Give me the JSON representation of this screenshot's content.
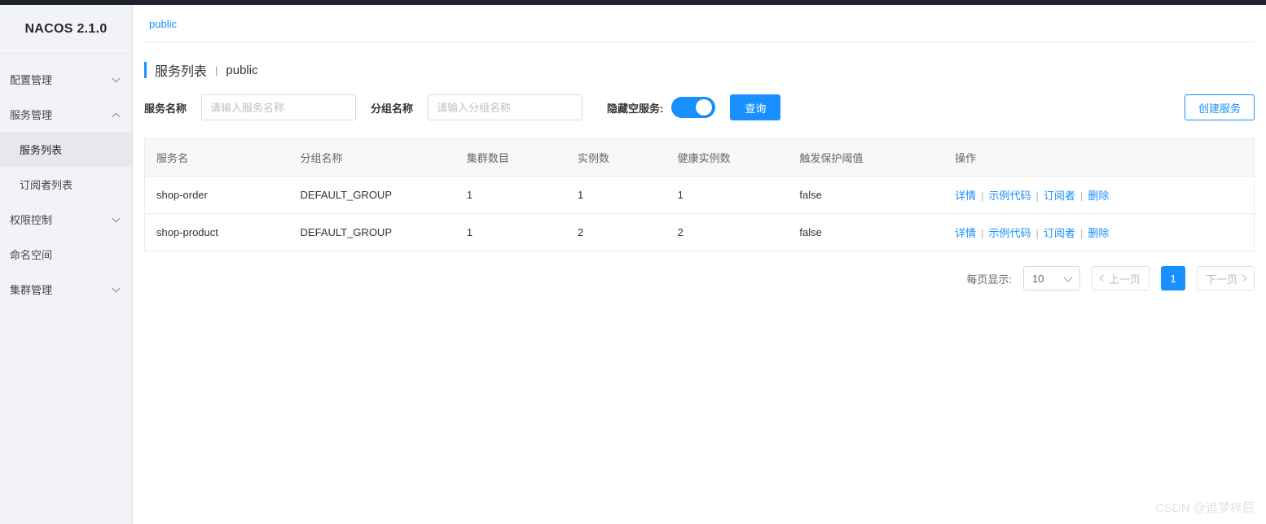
{
  "brand": "NACOS 2.1.0",
  "sidebar": {
    "items": [
      {
        "label": "配置管理",
        "expanded": false
      },
      {
        "label": "服务管理",
        "expanded": true,
        "children": [
          {
            "label": "服务列表",
            "active": true
          },
          {
            "label": "订阅者列表",
            "active": false
          }
        ]
      },
      {
        "label": "权限控制",
        "expanded": false
      },
      {
        "label": "命名空间"
      },
      {
        "label": "集群管理",
        "expanded": false
      }
    ]
  },
  "namespace_tab": "public",
  "title": {
    "main": "服务列表",
    "sep": "|",
    "ns": "public"
  },
  "filters": {
    "service_label": "服务名称",
    "service_placeholder": "请输入服务名称",
    "group_label": "分组名称",
    "group_placeholder": "请输入分组名称",
    "hide_empty_label": "隐藏空服务:",
    "search_btn": "查询",
    "create_btn": "创建服务"
  },
  "table": {
    "headers": [
      "服务名",
      "分组名称",
      "集群数目",
      "实例数",
      "健康实例数",
      "触发保护阈值",
      "操作"
    ],
    "rows": [
      {
        "name": "shop-order",
        "group": "DEFAULT_GROUP",
        "clusters": "1",
        "instances": "1",
        "healthy": "1",
        "threshold": "false"
      },
      {
        "name": "shop-product",
        "group": "DEFAULT_GROUP",
        "clusters": "1",
        "instances": "2",
        "healthy": "2",
        "threshold": "false"
      }
    ],
    "ops": {
      "detail": "详情",
      "code": "示例代码",
      "subscriber": "订阅者",
      "delete": "删除"
    }
  },
  "pager": {
    "per_page_label": "每页显示:",
    "per_page_value": "10",
    "prev": "上一页",
    "current": "1",
    "next": "下一页"
  },
  "watermark": "CSDN @追梦梓辰"
}
